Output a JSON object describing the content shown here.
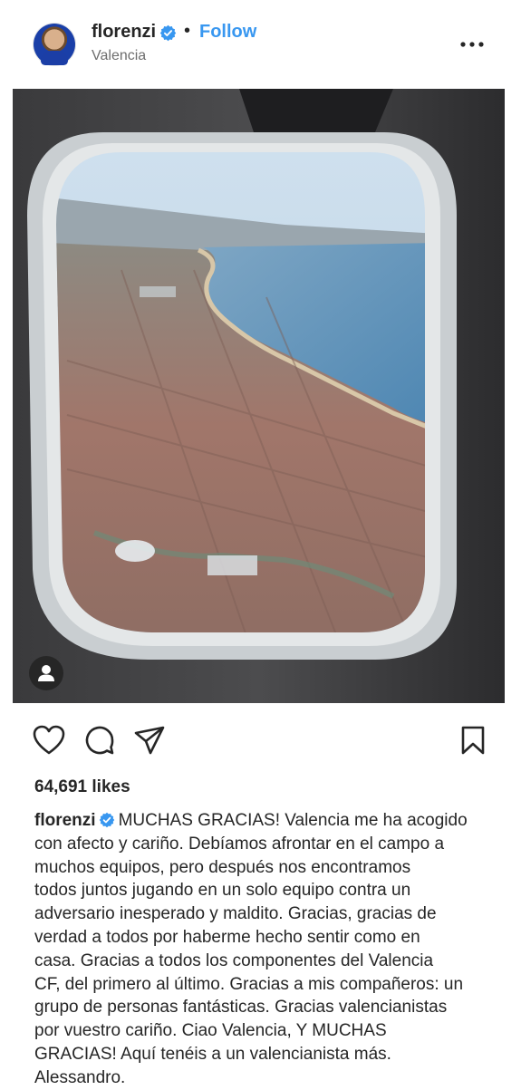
{
  "post": {
    "username": "florenzi",
    "dot": "•",
    "follow_label": "Follow",
    "location": "Valencia",
    "likes": "64,691 likes"
  },
  "caption": {
    "username": "florenzi",
    "lines": [
      "MUCHAS GRACIAS! Valencia me ha acogido",
      "con afecto y cariño. Debíamos afrontar en el campo a",
      "muchos equipos, pero después nos encontramos",
      "todos juntos jugando en un solo equipo contra un",
      "adversario inesperado y maldito. Gracias, gracias de",
      "verdad a todos por haberme hecho sentir como en",
      "casa. Gracias a todos los componentes del Valencia",
      "CF, del primero al último. Gracias a mis compañeros: un",
      "grupo de personas fantásticas. Gracias valencianistas",
      "por vuestro cariño. Ciao Valencia, Y MUCHAS",
      "GRACIAS! Aquí tenéis a un valencianista más.",
      "Alessandro."
    ]
  },
  "icons": {
    "verified": "verified-badge-icon",
    "more": "more-options-icon",
    "like": "heart-icon",
    "comment": "comment-bubble-icon",
    "share": "paper-plane-icon",
    "save": "bookmark-icon",
    "tag": "person-tag-icon"
  },
  "colors": {
    "accent": "#3897f0",
    "text": "#262626",
    "secondary": "#6e6e6e"
  }
}
